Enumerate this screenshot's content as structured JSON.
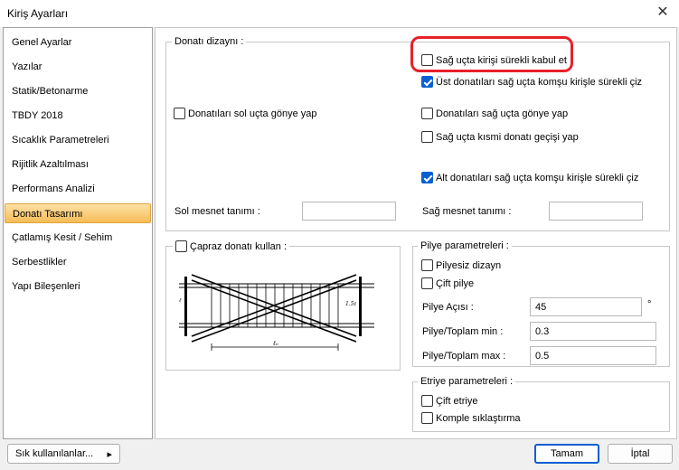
{
  "window": {
    "title": "Kiriş Ayarları",
    "close_glyph": "✕"
  },
  "sidebar": {
    "items": [
      {
        "label": "Genel Ayarlar"
      },
      {
        "label": "Yazılar"
      },
      {
        "label": "Statik/Betonarme"
      },
      {
        "label": "TBDY 2018"
      },
      {
        "label": "Sıcaklık Parametreleri"
      },
      {
        "label": "Rijitlik Azaltılması"
      },
      {
        "label": "Performans Analizi"
      },
      {
        "label": "Donatı Tasarımı",
        "active": true
      },
      {
        "label": "Çatlamış Kesit / Sehim"
      },
      {
        "label": "Serbestlikler"
      },
      {
        "label": "Yapı Bileşenleri"
      }
    ]
  },
  "donati": {
    "legend": "Donatı dizaynı :",
    "sol_gonye": {
      "label": "Donatıları sol uçta gönye yap",
      "checked": false
    },
    "sag_surekli": {
      "label": "Sağ uçta kirişi sürekli kabul et",
      "checked": false
    },
    "ust_surekli": {
      "label": "Üst donatıları sağ uçta komşu kirişle sürekli çiz",
      "checked": true
    },
    "sag_gonye": {
      "label": "Donatıları sağ uçta gönye yap",
      "checked": false
    },
    "sag_kismi": {
      "label": "Sağ uçta kısmi donatı geçişi yap",
      "checked": false
    },
    "alt_surekli": {
      "label": "Alt donatıları sağ uçta komşu kirişle sürekli çiz",
      "checked": true
    },
    "sol_mesnet_label": "Sol mesnet tanımı :",
    "sol_mesnet_value": "",
    "sag_mesnet_label": "Sağ mesnet tanımı :",
    "sag_mesnet_value": ""
  },
  "capraz": {
    "label": "Çapraz donatı kullan :",
    "checked": false,
    "diagram_labels": {
      "dim1": "1.5ℓ",
      "dim2": "ℓ",
      "span": "ℓₙ"
    }
  },
  "pilye": {
    "legend": "Pilye parametreleri :",
    "pilyesiz": {
      "label": "Pilyesiz dizayn",
      "checked": false
    },
    "cift": {
      "label": "Çift pilye",
      "checked": false
    },
    "aci_label": "Pilye Açısı :",
    "aci_value": "45",
    "aci_unit": "°",
    "min_label": "Pilye/Toplam min :",
    "min_value": "0.3",
    "max_label": "Pilye/Toplam max :",
    "max_value": "0.5"
  },
  "etriye": {
    "legend": "Etriye parametreleri :",
    "cift": {
      "label": "Çift etriye",
      "checked": false
    },
    "komple": {
      "label": "Komple sıklaştırma",
      "checked": false
    }
  },
  "footer": {
    "favorites_label": "Sık kullanılanlar...",
    "favorites_arrow": "▸",
    "ok_label": "Tamam",
    "cancel_label": "İptal"
  }
}
